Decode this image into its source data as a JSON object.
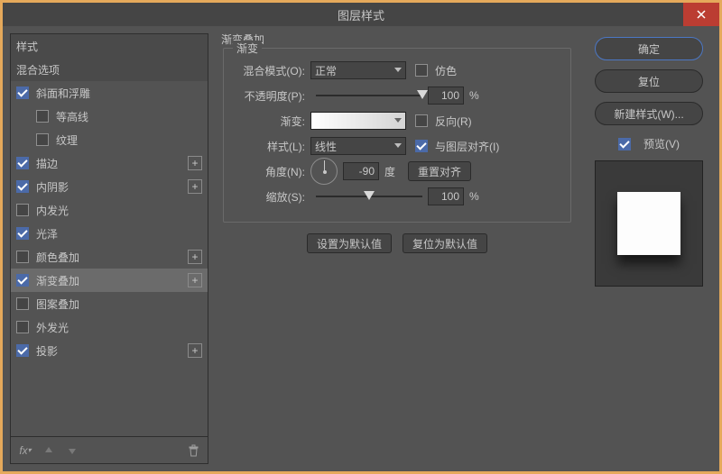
{
  "window": {
    "title": "图层样式"
  },
  "left": {
    "header_styles": "样式",
    "header_blend": "混合选项",
    "items": [
      {
        "label": "斜面和浮雕",
        "checked": true,
        "plus": false,
        "indent": false
      },
      {
        "label": "等高线",
        "checked": false,
        "plus": false,
        "indent": true
      },
      {
        "label": "纹理",
        "checked": false,
        "plus": false,
        "indent": true
      },
      {
        "label": "描边",
        "checked": true,
        "plus": true,
        "indent": false
      },
      {
        "label": "内阴影",
        "checked": true,
        "plus": true,
        "indent": false
      },
      {
        "label": "内发光",
        "checked": false,
        "plus": false,
        "indent": false
      },
      {
        "label": "光泽",
        "checked": true,
        "plus": false,
        "indent": false
      },
      {
        "label": "颜色叠加",
        "checked": false,
        "plus": true,
        "indent": false
      },
      {
        "label": "渐变叠加",
        "checked": true,
        "plus": true,
        "indent": false,
        "selected": true
      },
      {
        "label": "图案叠加",
        "checked": false,
        "plus": false,
        "indent": false
      },
      {
        "label": "外发光",
        "checked": false,
        "plus": false,
        "indent": false
      },
      {
        "label": "投影",
        "checked": true,
        "plus": true,
        "indent": false
      }
    ]
  },
  "center": {
    "section_title": "渐变叠加",
    "legend": "渐变",
    "blend_mode": {
      "label": "混合模式(O):",
      "value": "正常"
    },
    "dither": {
      "label": "仿色",
      "checked": false
    },
    "opacity": {
      "label": "不透明度(P):",
      "value": "100",
      "unit": "%",
      "pos": 100
    },
    "gradient": {
      "label": "渐变:"
    },
    "reverse": {
      "label": "反向(R)",
      "checked": false
    },
    "style": {
      "label": "样式(L):",
      "value": "线性"
    },
    "align": {
      "label": "与图层对齐(I)",
      "checked": true
    },
    "angle": {
      "label": "角度(N):",
      "value": "-90",
      "unit": "度",
      "reset": "重置对齐"
    },
    "scale": {
      "label": "缩放(S):",
      "value": "100",
      "unit": "%",
      "pos": 50
    },
    "set_default": "设置为默认值",
    "reset_default": "复位为默认值"
  },
  "right": {
    "ok": "确定",
    "cancel": "复位",
    "new_style": "新建样式(W)...",
    "preview_label": "预览(V)",
    "preview_checked": true
  }
}
